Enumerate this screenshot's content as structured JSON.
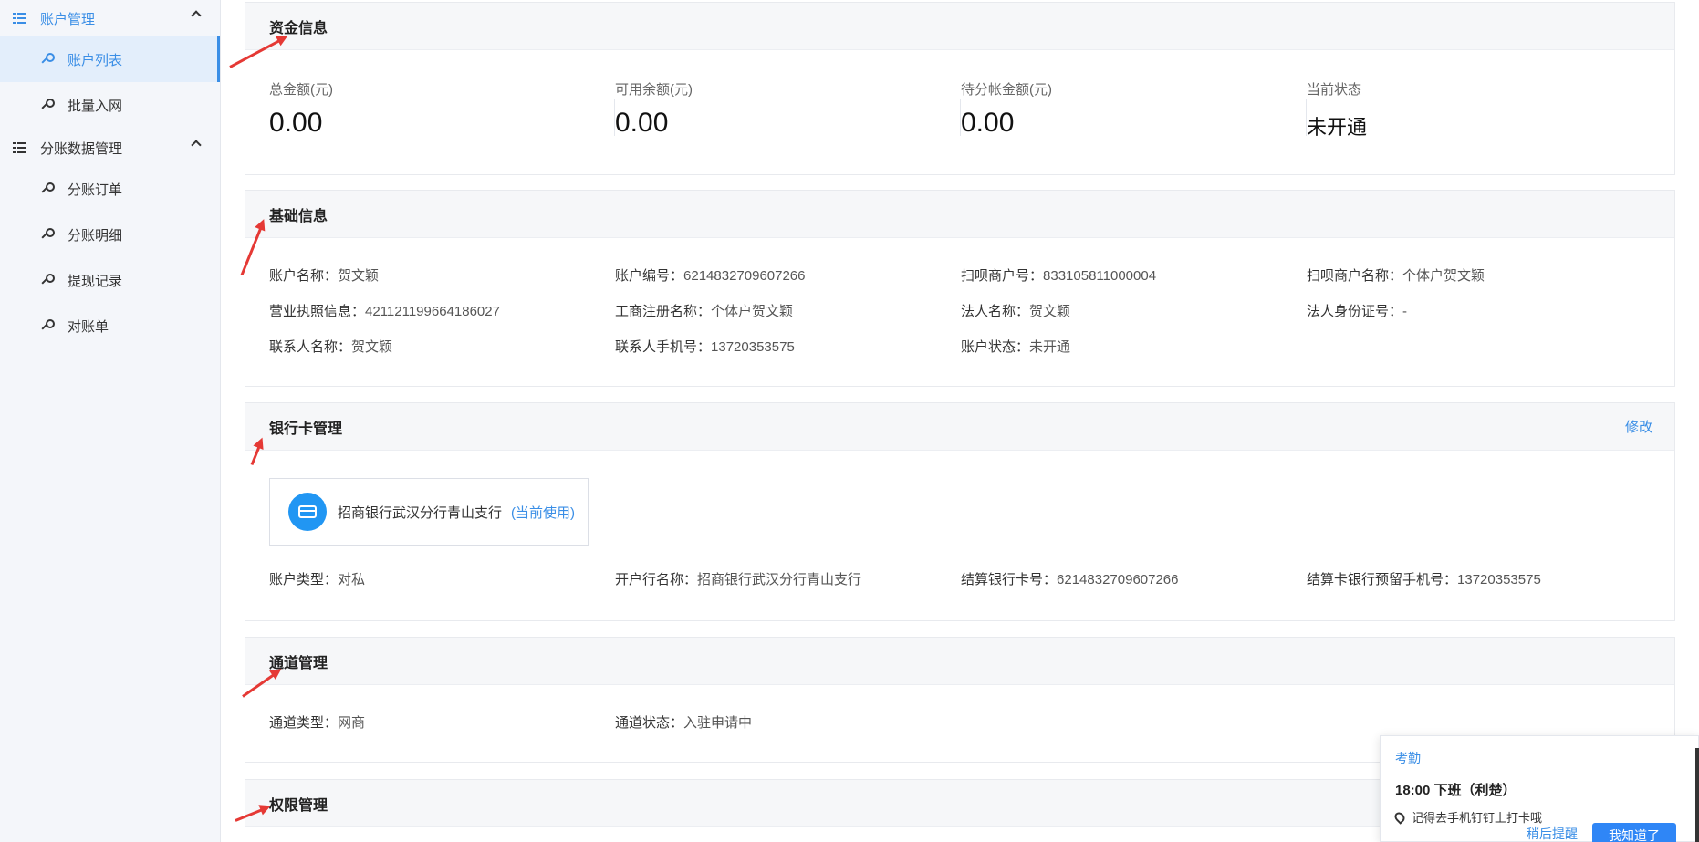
{
  "sidebar": {
    "groups": [
      {
        "label": "账户管理",
        "items": [
          "账户列表",
          "批量入网"
        ]
      },
      {
        "label": "分账数据管理",
        "items": [
          "分账订单",
          "分账明细",
          "提现记录",
          "对账单"
        ]
      }
    ]
  },
  "fund": {
    "title": "资金信息",
    "items": [
      {
        "label": "总金额(元)",
        "value": "0.00"
      },
      {
        "label": "可用余额(元)",
        "value": "0.00"
      },
      {
        "label": "待分帐金额(元)",
        "value": "0.00"
      },
      {
        "label": "当前状态",
        "value": "未开通"
      }
    ]
  },
  "basic": {
    "title": "基础信息",
    "rows": [
      [
        {
          "k": "账户名称：",
          "v": "贺文颖"
        },
        {
          "k": "账户编号：",
          "v": "6214832709607266"
        },
        {
          "k": "扫呗商户号：",
          "v": "833105811000004"
        },
        {
          "k": "扫呗商户名称：",
          "v": "个体户贺文颖"
        }
      ],
      [
        {
          "k": "营业执照信息：",
          "v": "421121199664186027"
        },
        {
          "k": "工商注册名称：",
          "v": "个体户贺文颖"
        },
        {
          "k": "法人名称：",
          "v": "贺文颖"
        },
        {
          "k": "法人身份证号：",
          "v": "-"
        }
      ],
      [
        {
          "k": "联系人名称：",
          "v": "贺文颖"
        },
        {
          "k": "联系人手机号：",
          "v": "13720353575"
        },
        {
          "k": "账户状态：",
          "v": "未开通"
        }
      ]
    ]
  },
  "bank": {
    "title": "银行卡管理",
    "edit": "修改",
    "card_name": "招商银行武汉分行青山支行",
    "card_tag": "(当前使用)",
    "fields": [
      {
        "k": "账户类型：",
        "v": "对私"
      },
      {
        "k": "开户行名称：",
        "v": "招商银行武汉分行青山支行"
      },
      {
        "k": "结算银行卡号：",
        "v": "6214832709607266"
      },
      {
        "k": "结算卡银行预留手机号：",
        "v": "13720353575"
      }
    ]
  },
  "channel": {
    "title": "通道管理",
    "fields": [
      {
        "k": "通道类型：",
        "v": "网商"
      },
      {
        "k": "通道状态：",
        "v": "入驻申请中"
      }
    ]
  },
  "permission": {
    "title": "权限管理"
  },
  "notice": {
    "app": "考勤",
    "title": "18:00 下班（利楚）",
    "line": "记得去手机钉钉上打卡哦",
    "later": "稍后提醒",
    "ok": "我知道了"
  },
  "colors": {
    "accent": "#3a8ee6",
    "arrow": "#e53935"
  }
}
